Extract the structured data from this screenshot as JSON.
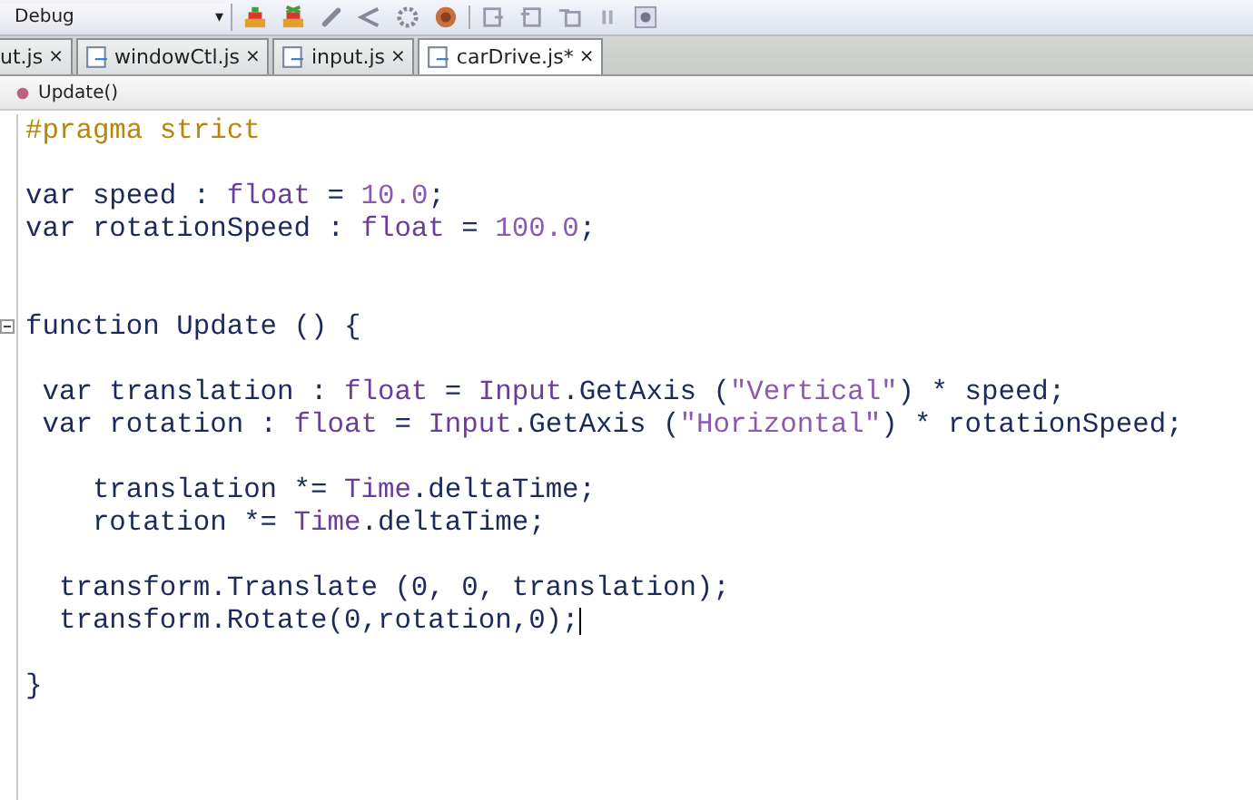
{
  "toolbar": {
    "configuration": "Debug",
    "dropdown_arrow": "▾"
  },
  "tabs": [
    {
      "label": "ut.js",
      "selected": false,
      "close": "×"
    },
    {
      "label": "windowCtl.js",
      "selected": false,
      "close": "×"
    },
    {
      "label": "input.js",
      "selected": false,
      "close": "×"
    },
    {
      "label": "carDrive.js*",
      "selected": true,
      "close": "×"
    }
  ],
  "breadcrumb": {
    "item": "Update()"
  },
  "code": [
    {
      "kind": "code",
      "tokens": [
        {
          "kind": "pragma",
          "text": "#pragma strict"
        }
      ]
    },
    {
      "kind": "blank"
    },
    {
      "kind": "code",
      "tokens": [
        {
          "kind": "plain",
          "text": "var speed : "
        },
        {
          "kind": "type",
          "text": "float"
        },
        {
          "kind": "plain",
          "text": " = "
        },
        {
          "kind": "number",
          "text": "10.0"
        },
        {
          "kind": "plain",
          "text": ";"
        }
      ]
    },
    {
      "kind": "code",
      "tokens": [
        {
          "kind": "plain",
          "text": "var rotationSpeed : "
        },
        {
          "kind": "type",
          "text": "float"
        },
        {
          "kind": "plain",
          "text": " = "
        },
        {
          "kind": "number",
          "text": "100.0"
        },
        {
          "kind": "plain",
          "text": ";"
        }
      ]
    },
    {
      "kind": "blank"
    },
    {
      "kind": "blank"
    },
    {
      "kind": "code",
      "fold": true,
      "tokens": [
        {
          "kind": "plain",
          "text": "function Update () {"
        }
      ]
    },
    {
      "kind": "blank"
    },
    {
      "kind": "code",
      "tokens": [
        {
          "kind": "plain",
          "text": " var translation : "
        },
        {
          "kind": "type",
          "text": "float"
        },
        {
          "kind": "plain",
          "text": " = "
        },
        {
          "kind": "class",
          "text": "Input"
        },
        {
          "kind": "plain",
          "text": ".GetAxis ("
        },
        {
          "kind": "string",
          "text": "\"Vertical\""
        },
        {
          "kind": "plain",
          "text": ") * speed;"
        }
      ]
    },
    {
      "kind": "code",
      "tokens": [
        {
          "kind": "plain",
          "text": " var rotation : "
        },
        {
          "kind": "type",
          "text": "float"
        },
        {
          "kind": "plain",
          "text": " = "
        },
        {
          "kind": "class",
          "text": "Input"
        },
        {
          "kind": "plain",
          "text": ".GetAxis ("
        },
        {
          "kind": "string",
          "text": "\"Horizontal\""
        },
        {
          "kind": "plain",
          "text": ") * rotationSpeed;"
        }
      ]
    },
    {
      "kind": "blank"
    },
    {
      "kind": "code",
      "tokens": [
        {
          "kind": "plain",
          "text": "    translation *= "
        },
        {
          "kind": "class",
          "text": "Time"
        },
        {
          "kind": "plain",
          "text": ".deltaTime;"
        }
      ]
    },
    {
      "kind": "code",
      "tokens": [
        {
          "kind": "plain",
          "text": "    rotation *= "
        },
        {
          "kind": "class",
          "text": "Time"
        },
        {
          "kind": "plain",
          "text": ".deltaTime;"
        }
      ]
    },
    {
      "kind": "blank"
    },
    {
      "kind": "code",
      "tokens": [
        {
          "kind": "plain",
          "text": "  transform.Translate (0, 0, translation);"
        }
      ]
    },
    {
      "kind": "code",
      "cursor": true,
      "tokens": [
        {
          "kind": "plain",
          "text": "  transform.Rotate(0,rotation,0);"
        }
      ]
    },
    {
      "kind": "blank"
    },
    {
      "kind": "code",
      "tokens": [
        {
          "kind": "plain",
          "text": "}"
        }
      ]
    }
  ]
}
